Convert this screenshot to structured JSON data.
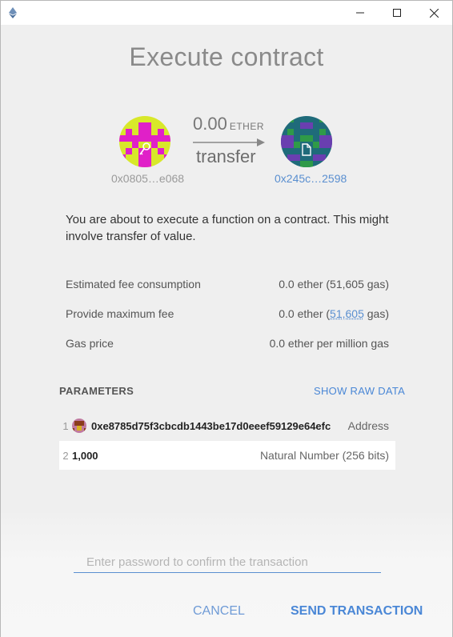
{
  "window": {
    "minimize_icon": "minimize-icon",
    "maximize_icon": "maximize-icon",
    "close_icon": "close-icon"
  },
  "title": "Execute contract",
  "transfer": {
    "amount": "0.00",
    "unit": "ETHER",
    "action": "transfer",
    "from_address": "0x0805…e068",
    "to_address": "0x245c…2598"
  },
  "description": "You are about to execute a function on a contract. This might involve transfer of value.",
  "fees": [
    {
      "label": "Estimated fee consumption",
      "value": "0.0 ether (51,605 gas)"
    },
    {
      "label": "Provide maximum fee",
      "value_prefix": "0.0 ether (",
      "value_link": "51,605",
      "value_suffix": " gas)"
    },
    {
      "label": "Gas price",
      "value": "0.0 ether per million gas"
    }
  ],
  "parameters": {
    "heading": "PARAMETERS",
    "raw_link": "SHOW RAW DATA",
    "items": [
      {
        "index": "1",
        "value": "0xe8785d75f3cbcdb1443be17d0eeef59129e64efc",
        "type": "Address"
      },
      {
        "index": "2",
        "value": "1,000",
        "type": "Natural Number (256 bits)"
      }
    ]
  },
  "password": {
    "placeholder": "Enter password to confirm the transaction"
  },
  "buttons": {
    "cancel": "CANCEL",
    "send": "SEND TRANSACTION"
  },
  "colors": {
    "accent": "#4a87d6",
    "link": "#5a8fd0"
  }
}
